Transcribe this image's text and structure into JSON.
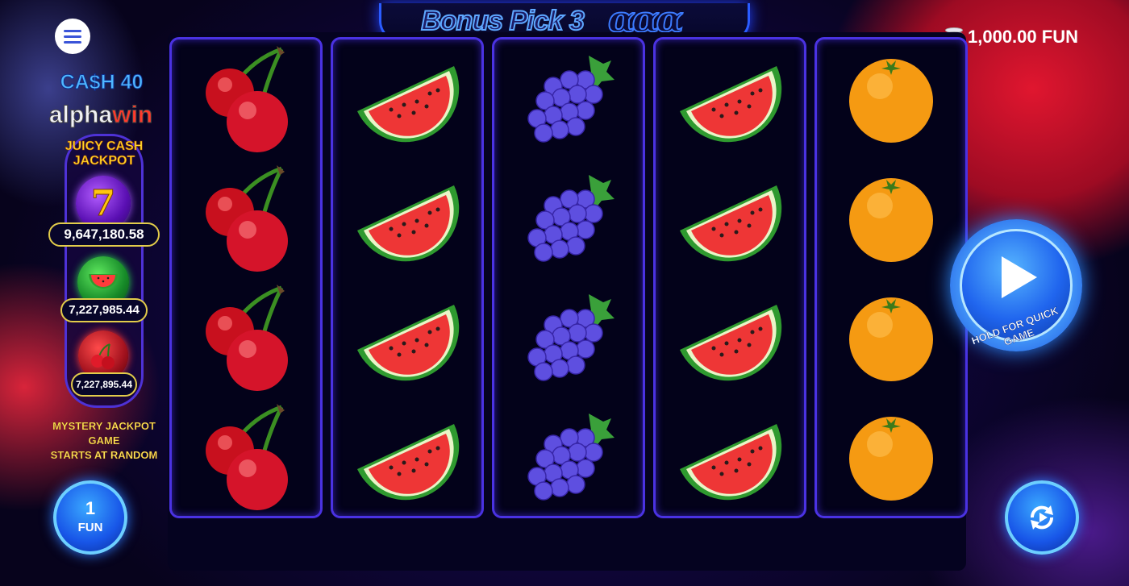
{
  "header": {
    "game_title": "Bonus Pick 3",
    "title_suffix": "ααα",
    "balance": "1,000.00 FUN",
    "menu_icon": "hamburger-menu-icon"
  },
  "branding": {
    "cash_logo": "CA$H 40",
    "alpha_part": "alpha",
    "win_part": "win"
  },
  "jackpot": {
    "title_line1": "JUICY CASH",
    "title_line2": "JACKPOT",
    "tiers": [
      {
        "icon": "seven-icon",
        "glyph": "7",
        "value": "9,647,180.58",
        "color": "#8a2be2"
      },
      {
        "icon": "watermelon-icon",
        "value": "7,227,985.44",
        "color": "#22b33a"
      },
      {
        "icon": "cherry-icon",
        "value": "7,227,895.44",
        "color": "#d4182a"
      }
    ],
    "mystery_line1": "MYSTERY JACKPOT GAME",
    "mystery_line2": "STARTS AT RANDOM"
  },
  "controls": {
    "bet_value": "1",
    "bet_unit": "FUN",
    "spin_hint": "HOLD FOR QUICK GAME",
    "autoplay_icon": "autoplay-icon"
  },
  "reels": [
    {
      "symbol": "cherry",
      "rows": 4
    },
    {
      "symbol": "watermelon",
      "rows": 4
    },
    {
      "symbol": "grapes",
      "rows": 4
    },
    {
      "symbol": "watermelon",
      "rows": 4
    },
    {
      "symbol": "orange",
      "rows": 4
    }
  ],
  "colors": {
    "accent": "#4a32e2",
    "balance": "#ffffff",
    "jackpot_gold": "#ffd92b"
  }
}
